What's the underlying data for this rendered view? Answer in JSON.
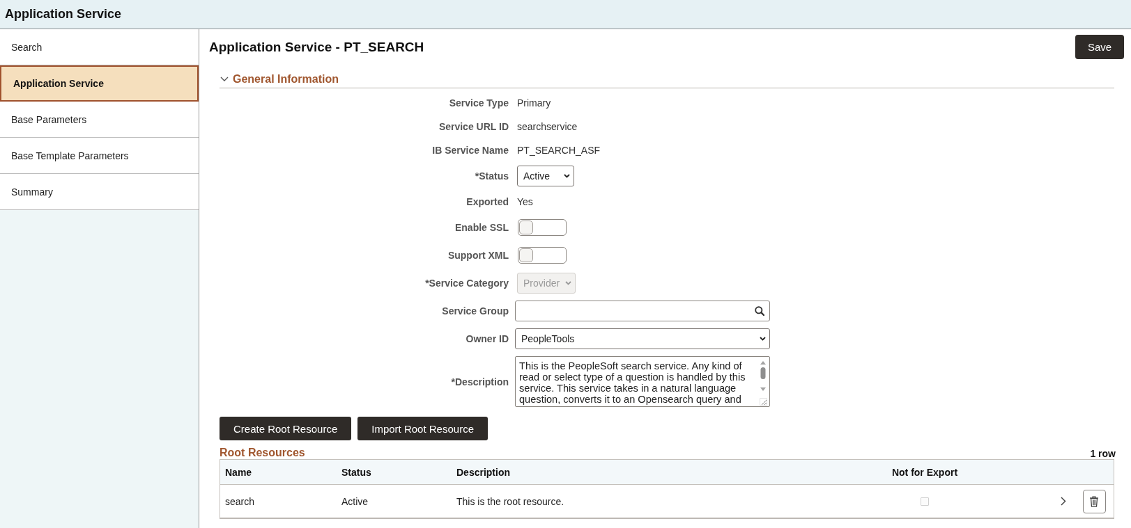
{
  "header": {
    "title": "Application Service"
  },
  "sidebar": {
    "items": [
      {
        "label": "Search",
        "selected": false
      },
      {
        "label": "Application Service",
        "selected": true
      },
      {
        "label": "Base Parameters",
        "selected": false
      },
      {
        "label": "Base Template Parameters",
        "selected": false
      },
      {
        "label": "Summary",
        "selected": false
      }
    ]
  },
  "page": {
    "title": "Application Service - PT_SEARCH",
    "save_button": "Save"
  },
  "section": {
    "title": "General Information",
    "expanded": true,
    "fields": [
      {
        "kind": "text",
        "label": "Service Type",
        "value": "Primary"
      },
      {
        "kind": "text",
        "label": "Service URL ID",
        "value": "searchservice"
      },
      {
        "kind": "text",
        "label": "IB Service Name",
        "value": "PT_SEARCH_ASF"
      },
      {
        "kind": "select",
        "label": "*Status",
        "value": "Active",
        "disabled": false
      },
      {
        "kind": "text",
        "label": "Exported",
        "value": "Yes"
      },
      {
        "kind": "toggle",
        "label": "Enable SSL",
        "on": false
      },
      {
        "kind": "toggle",
        "label": "Support XML",
        "on": false
      },
      {
        "kind": "select",
        "label": "*Service Category",
        "value": "Provider",
        "disabled": true
      },
      {
        "kind": "lookup",
        "label": "Service Group"
      },
      {
        "kind": "select",
        "label": "Owner ID",
        "value": "PeopleTools",
        "disabled": false
      },
      {
        "kind": "textarea",
        "label": "*Description",
        "value": "This is the PeopleSoft search service. Any kind of read or select type of a question is handled by this service. This service takes in a natural language question, converts it to an Opensearch query and"
      }
    ]
  },
  "actions": [
    "Create Root Resource",
    "Import Root Resource"
  ],
  "root_resources": {
    "title": "Root Resources",
    "count": "1 row",
    "columns": [
      "Name",
      "Status",
      "Description",
      "Not for Export"
    ],
    "rows": [
      {
        "name": "search",
        "status": "Active",
        "description": "This is the root resource.",
        "not_for_export": false
      }
    ]
  }
}
